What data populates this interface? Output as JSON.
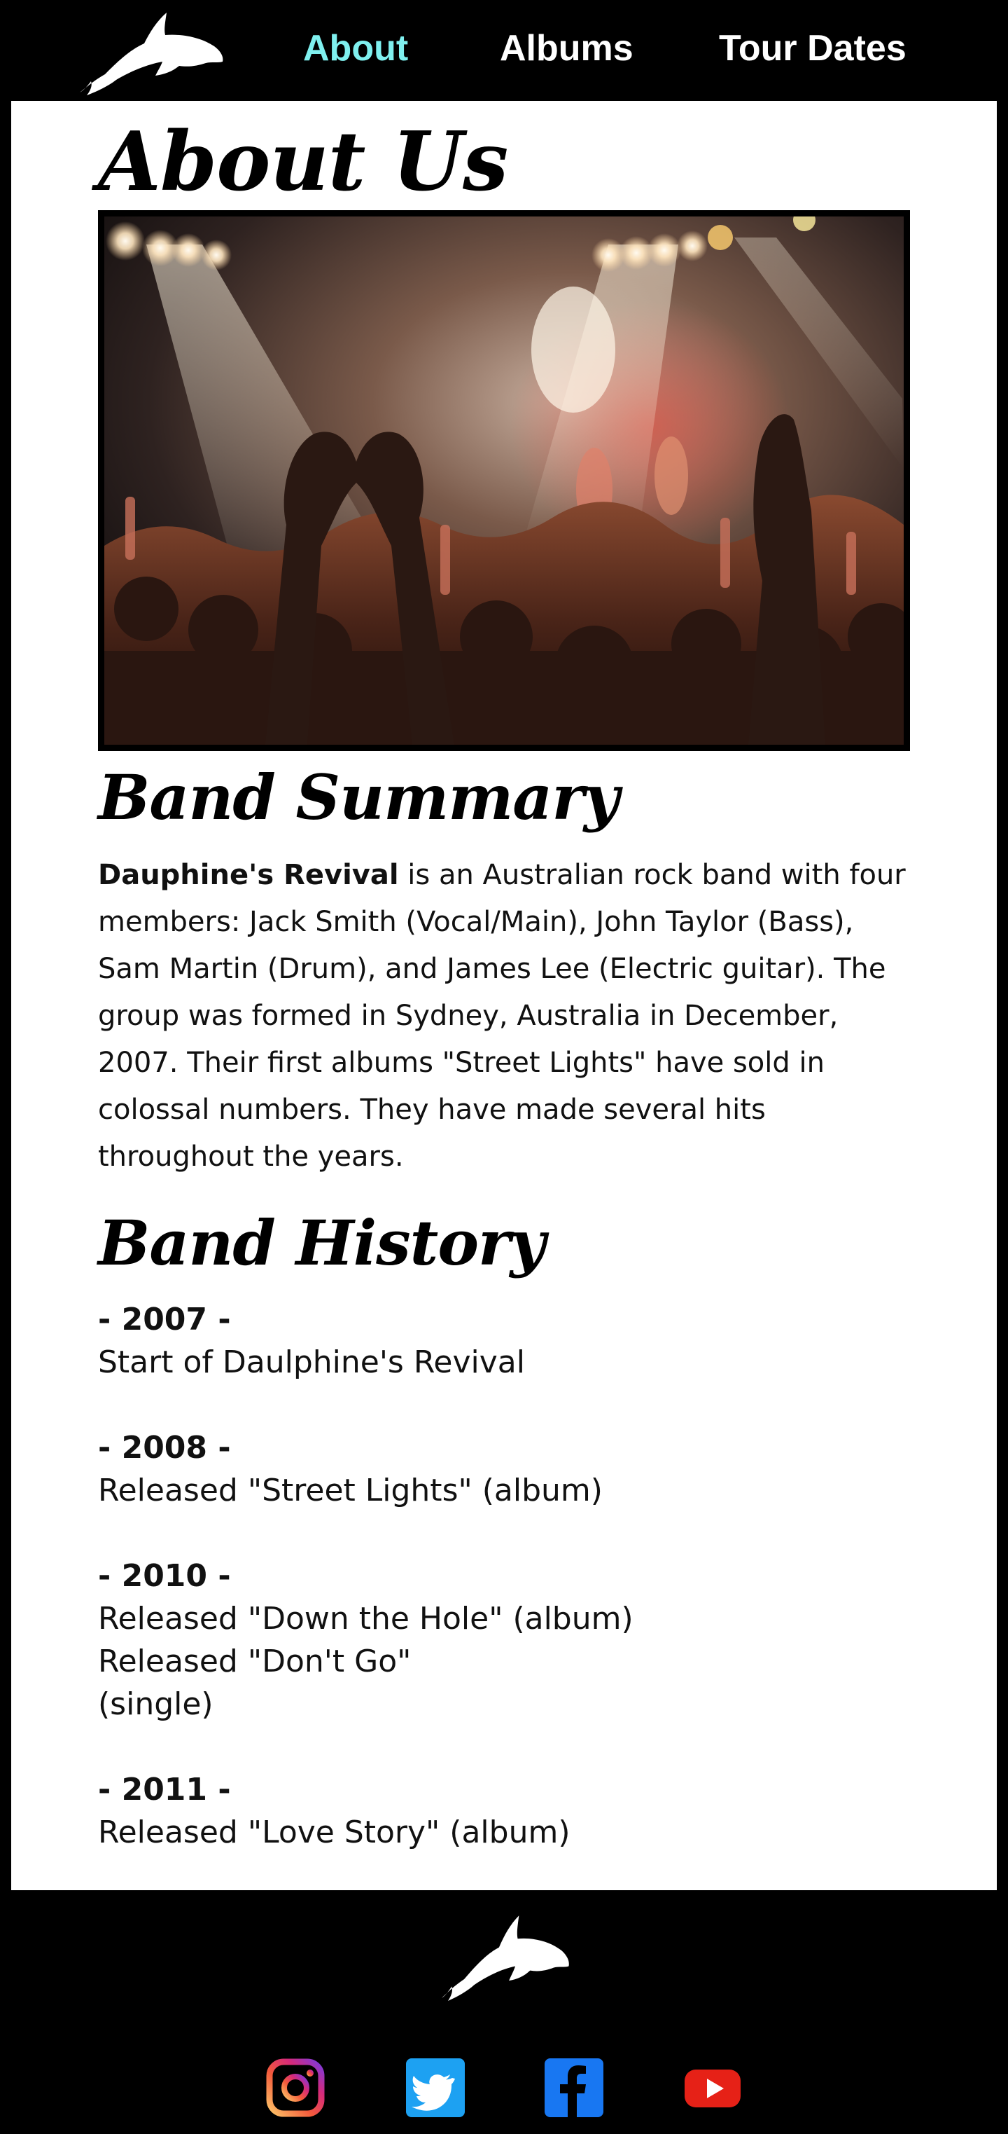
{
  "nav": {
    "items": [
      "About",
      "Albums",
      "Tour Dates"
    ],
    "active": "About",
    "active_color": "#7ff0ef"
  },
  "logo": {
    "icon": "dolphin-icon"
  },
  "page": {
    "title": "About Us"
  },
  "hero_image": {
    "icon": "concert-crowd-image"
  },
  "summary": {
    "heading": "Band Summary",
    "band_name": "Dauphine's Revival",
    "text": " is an Australian rock band with four members: Jack Smith (Vocal/Main), John Taylor (Bass), Sam Martin (Drum), and James Lee (Electric guitar). The group was formed in Sydney, Australia in December, 2007. Their first albums \"Street Lights\" have sold in colossal numbers. They have made several hits throughout the years."
  },
  "history": {
    "heading": "Band History",
    "entries": [
      {
        "year": "- 2007 -",
        "lines": [
          "Start of Daulphine's Revival"
        ]
      },
      {
        "year": "- 2008 -",
        "lines": [
          "Released \"Street Lights\" (album)"
        ]
      },
      {
        "year": "- 2010 -",
        "lines": [
          "Released \"Down the Hole\" (album)",
          "Released \"Don't Go\"",
          "(single)"
        ]
      },
      {
        "year": "- 2011 -",
        "lines": [
          "Released \"Love Story\" (album)"
        ]
      }
    ]
  },
  "footer": {
    "social": [
      "instagram-icon",
      "twitter-icon",
      "facebook-icon",
      "youtube-icon"
    ]
  },
  "colors": {
    "background": "#000000",
    "panel": "#ffffff",
    "accent": "#7ff0ef",
    "twitter": "#1da1f2",
    "facebook": "#1877f2",
    "youtube": "#e62117"
  }
}
